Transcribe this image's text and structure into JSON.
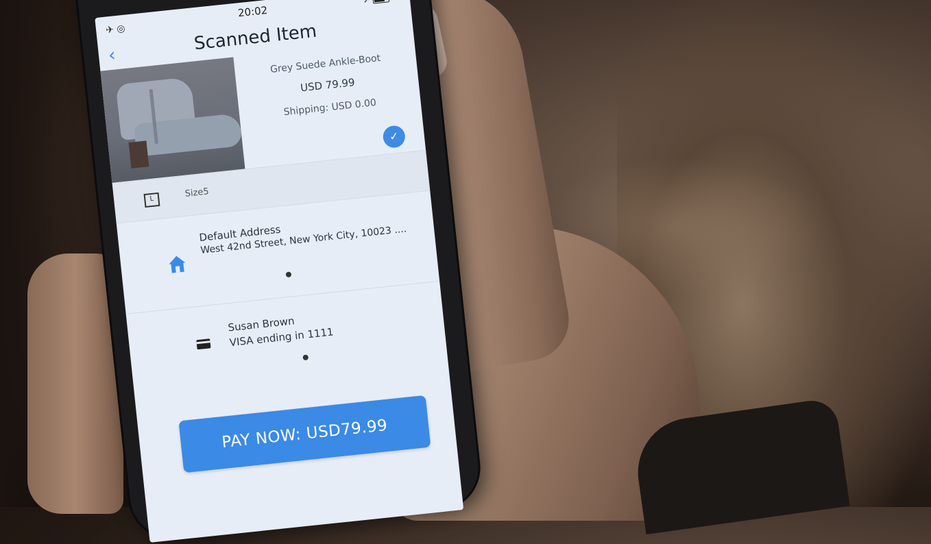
{
  "status_bar": {
    "time": "20:02"
  },
  "nav": {
    "title": "Scanned Item",
    "back_icon": "chevron-left-icon"
  },
  "product": {
    "name": "Grey Suede Ankle-Boot",
    "price": "USD 79.99",
    "shipping": "Shipping: USD 0.00",
    "selected": true
  },
  "size": {
    "icon_letter": "L",
    "label": "Size5"
  },
  "address": {
    "title": "Default Address",
    "line": "West 42nd Street, New York City, 10023 ...."
  },
  "payment": {
    "name": "Susan Brown",
    "card": "VISA ending in 1111"
  },
  "pay_button": {
    "label": "PAY NOW: USD79.99"
  },
  "colors": {
    "accent": "#3a8ae6",
    "screen_bg": "#e7edf6"
  }
}
